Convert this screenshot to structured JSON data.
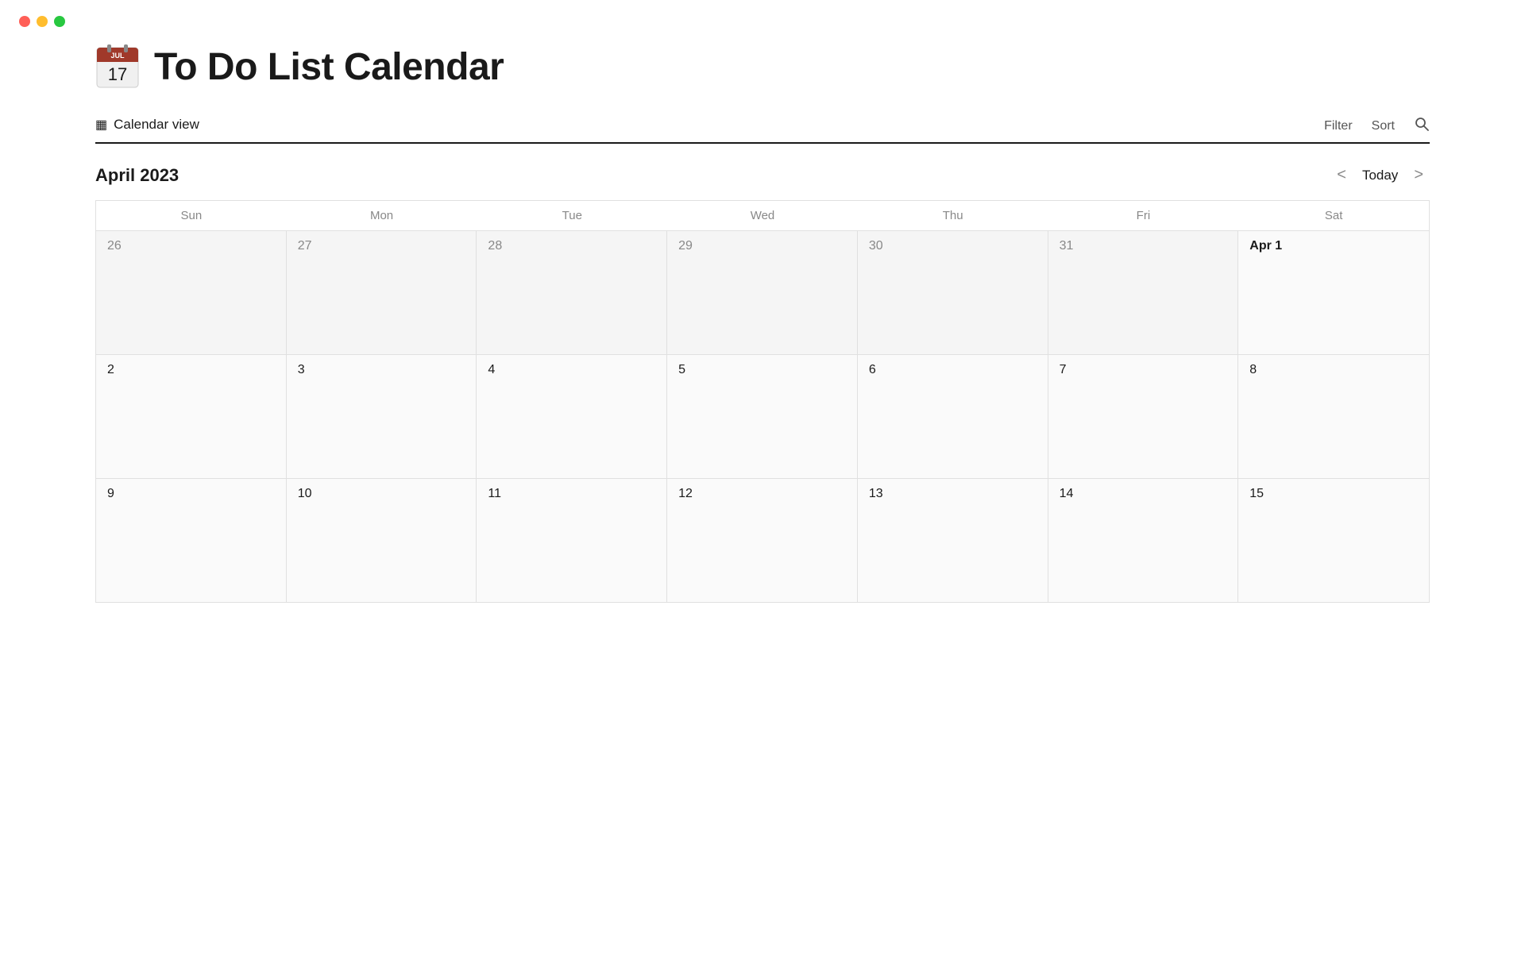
{
  "window": {
    "traffic_lights": [
      "red",
      "yellow",
      "green"
    ]
  },
  "header": {
    "icon_month": "JUL",
    "icon_day": "17",
    "title": "To Do List Calendar"
  },
  "toolbar": {
    "view_label": "Calendar view",
    "filter_label": "Filter",
    "sort_label": "Sort"
  },
  "calendar_nav": {
    "month_title": "April 2023",
    "today_label": "Today",
    "prev_label": "<",
    "next_label": ">"
  },
  "day_headers": [
    "Sun",
    "Mon",
    "Tue",
    "Wed",
    "Thu",
    "Fri",
    "Sat"
  ],
  "weeks": [
    {
      "days": [
        {
          "date": "26",
          "type": "other"
        },
        {
          "date": "27",
          "type": "other"
        },
        {
          "date": "28",
          "type": "other"
        },
        {
          "date": "29",
          "type": "other"
        },
        {
          "date": "30",
          "type": "other"
        },
        {
          "date": "31",
          "type": "other"
        },
        {
          "date": "Apr 1",
          "type": "first"
        }
      ]
    },
    {
      "days": [
        {
          "date": "2",
          "type": "current"
        },
        {
          "date": "3",
          "type": "current"
        },
        {
          "date": "4",
          "type": "current"
        },
        {
          "date": "5",
          "type": "current"
        },
        {
          "date": "6",
          "type": "current"
        },
        {
          "date": "7",
          "type": "current"
        },
        {
          "date": "8",
          "type": "current"
        }
      ]
    },
    {
      "days": [
        {
          "date": "9",
          "type": "current"
        },
        {
          "date": "10",
          "type": "current"
        },
        {
          "date": "11",
          "type": "current"
        },
        {
          "date": "12",
          "type": "current"
        },
        {
          "date": "13",
          "type": "current"
        },
        {
          "date": "14",
          "type": "current"
        },
        {
          "date": "15",
          "type": "current"
        }
      ]
    }
  ]
}
